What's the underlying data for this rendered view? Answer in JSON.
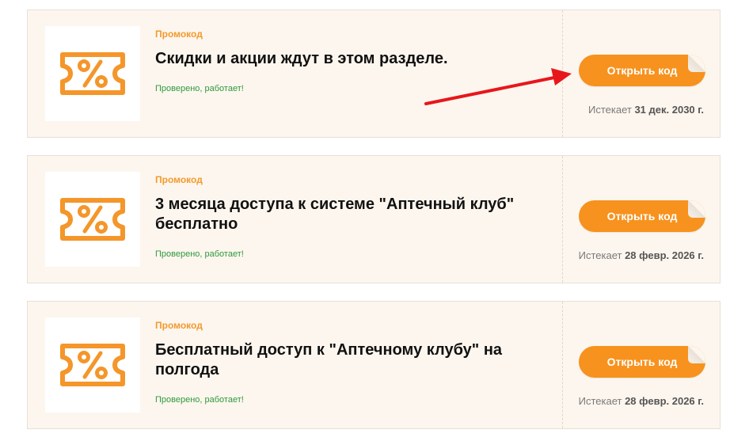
{
  "coupons": [
    {
      "type_label": "Промокод",
      "title": "Скидки и акции ждут в этом разделе.",
      "verified": "Проверено, работает!",
      "button_label": "Открыть код",
      "expires_prefix": "Истекает",
      "expires_date": "31 дек. 2030 г."
    },
    {
      "type_label": "Промокод",
      "title": "3 месяца доступа к системе \"Аптечный клуб\" бесплатно",
      "verified": "Проверено, работает!",
      "button_label": "Открыть код",
      "expires_prefix": "Истекает",
      "expires_date": "28 февр. 2026 г."
    },
    {
      "type_label": "Промокод",
      "title": "Бесплатный доступ к \"Аптечному клубу\" на полгода",
      "verified": "Проверено, работает!",
      "button_label": "Открыть код",
      "expires_prefix": "Истекает",
      "expires_date": "28 февр. 2026 г."
    }
  ],
  "colors": {
    "accent": "#f7921e",
    "label": "#f39a2c",
    "verified": "#2e9a3c",
    "card_bg": "#fdf6ee",
    "annotation_arrow": "#e8161b"
  },
  "icons": {
    "coupon_logo": "percent-ticket-icon",
    "annotation": "red-arrow-annotation"
  }
}
